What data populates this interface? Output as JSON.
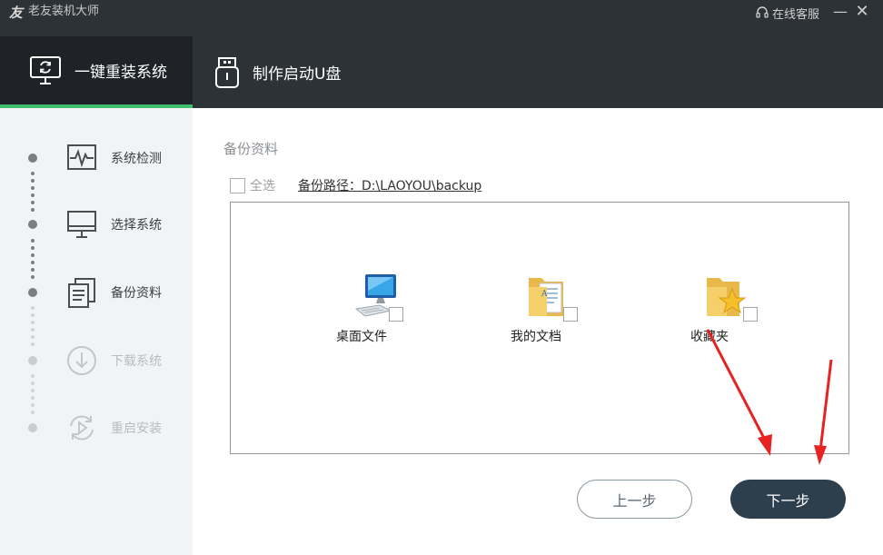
{
  "titlebar": {
    "app_title": "老友装机大师",
    "logo_glyph": "友",
    "support_label": "在线客服",
    "minimize_glyph": "—",
    "close_glyph": "✕"
  },
  "tabs": [
    {
      "label": "一键重装系统",
      "active": true
    },
    {
      "label": "制作启动U盘",
      "active": false
    }
  ],
  "steps": [
    {
      "label": "系统检测",
      "done": true
    },
    {
      "label": "选择系统",
      "done": true
    },
    {
      "label": "备份资料",
      "done": true
    },
    {
      "label": "下载系统",
      "done": false
    },
    {
      "label": "重启安装",
      "done": false
    }
  ],
  "main": {
    "section_title": "备份资料",
    "select_all_label": "全选",
    "backup_path_label": "备份路径：D:\\LAOYOU\\backup",
    "items": [
      {
        "label": "桌面文件",
        "icon": "desktop-computer-icon",
        "checked": false
      },
      {
        "label": "我的文档",
        "icon": "documents-folder-icon",
        "checked": false
      },
      {
        "label": "收藏夹",
        "icon": "favorites-folder-icon",
        "checked": false
      }
    ]
  },
  "buttons": {
    "prev_label": "上一步",
    "next_label": "下一步"
  },
  "colors": {
    "header_bg": "#2d3237",
    "accent_green": "#3fbf6e",
    "primary_button": "#2d3e4c",
    "annotation_red": "#e62222"
  }
}
